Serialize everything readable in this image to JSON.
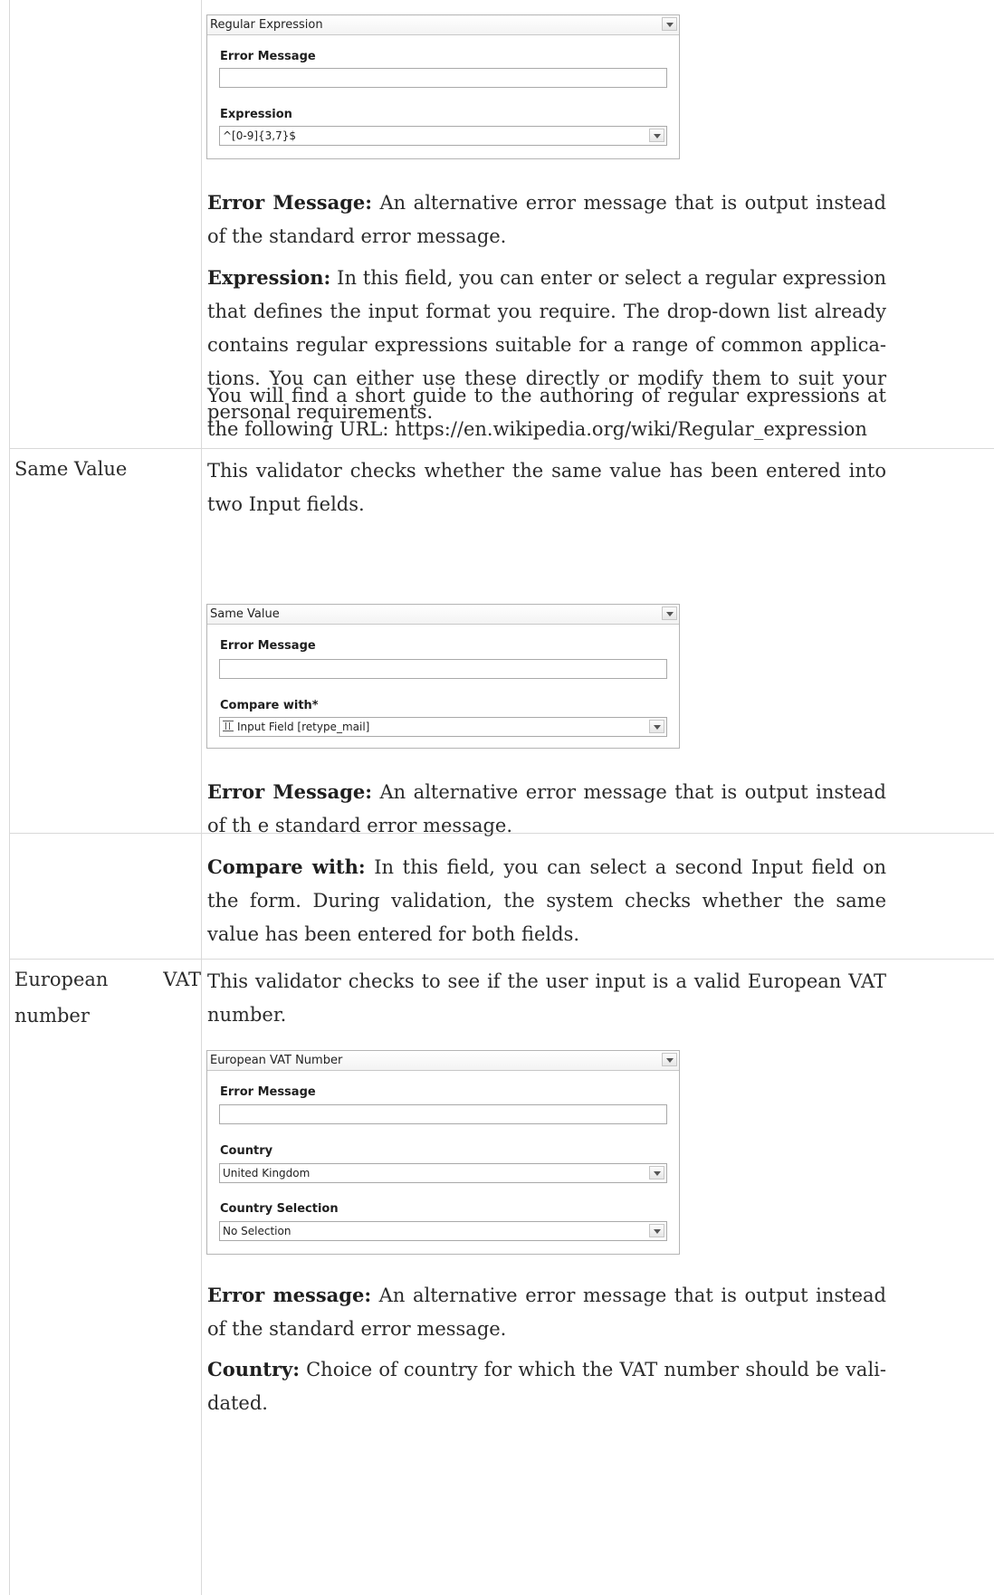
{
  "regex_section": {
    "widget": {
      "header": "Regular Expression",
      "error_label": "Error Message",
      "expression_label": "Expression",
      "expression_value": "^[0-9]{3,7}$"
    },
    "p1_bold": "Error Message:",
    "p1_text": " An alternative error message that is output instead of the standard error message.",
    "p2_bold": "Expression:",
    "p2_text": "  In this field, you can enter or select a regular expression that defines the input format you require. The drop-down list already contains regular expressions suitable for a range of common applica­tions. You can either use these directly or modify them to suit your personal requirements.",
    "p3_text": "You will find a short guide to the authoring of regular expressions at the following URL: https://en.wikipedia.org/wiki/Regular_expression"
  },
  "same_value": {
    "name": "Same Value",
    "intro": "This validator checks whether the same value has been entered into two Input fields.",
    "widget": {
      "header": "Same Value",
      "error_label": "Error Message",
      "compare_label": "Compare with*",
      "compare_value": "Input Field [retype_mail]"
    },
    "p1_bold": "Error Message:",
    "p1_text": " An alternative error message that is output instead of th e standard error message.",
    "p2_bold": "Compare with:",
    "p2_text": " In this field, you can select a second Input field on the form. During validation, the system checks whether the same value has been entered for both fields."
  },
  "vat": {
    "name": "European VAT number",
    "intro": "This validator checks to see if the user input is a valid European VAT number.",
    "widget": {
      "header": "European VAT Number",
      "error_label": "Error Message",
      "country_label": "Country",
      "country_value": "United Kingdom",
      "selection_label": "Country Selection",
      "selection_value": "No Selection"
    },
    "p1_bold": "Error message:",
    "p1_text": " An alternative error message that is output instead of the standard error message.",
    "p2_bold": "Country:",
    "p2_text": "  Choice of country for which the VAT number should be vali­dated."
  }
}
